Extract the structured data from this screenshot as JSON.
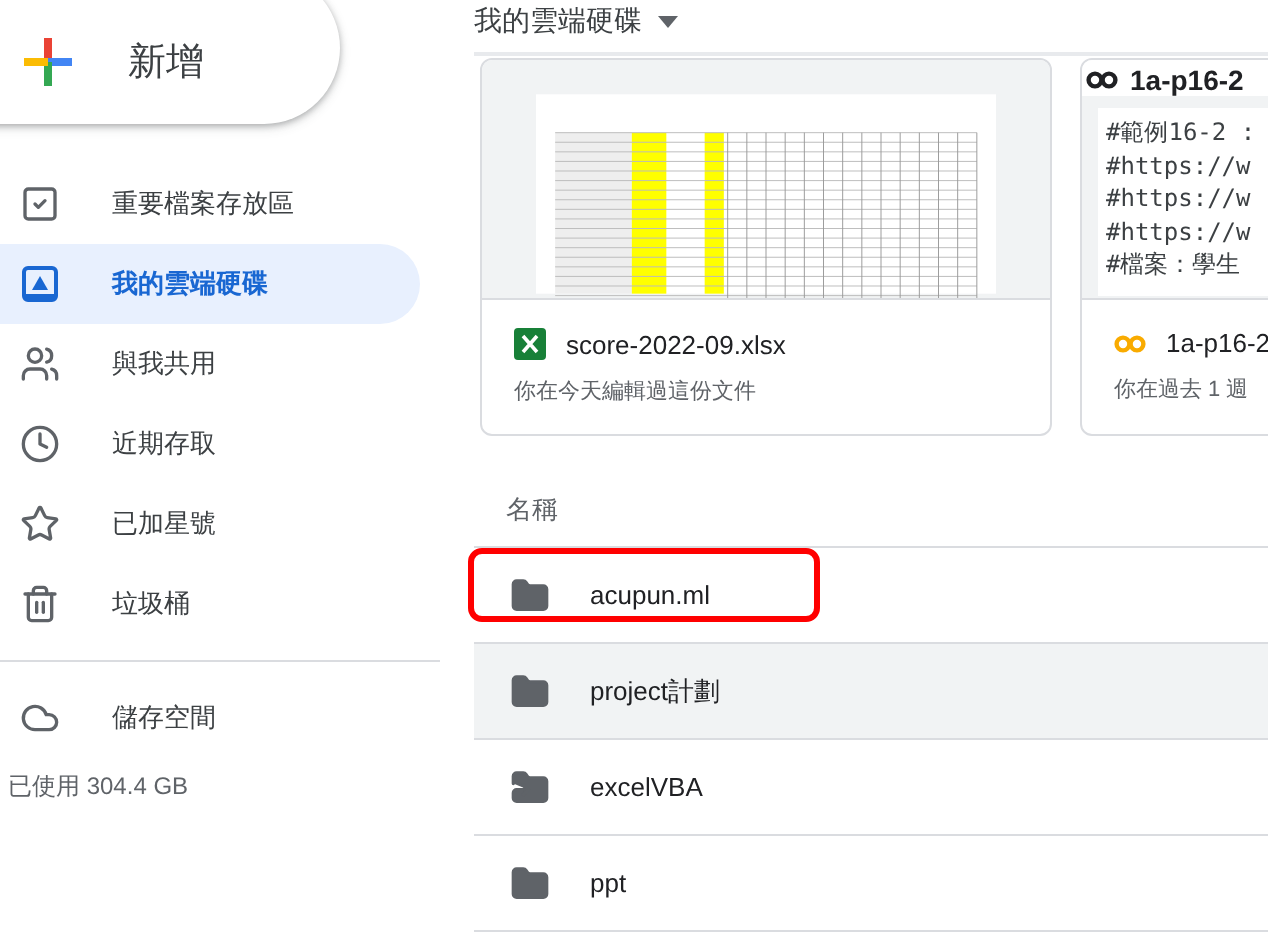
{
  "new_button": {
    "label": "新增"
  },
  "sidebar": {
    "items": [
      {
        "label": "重要檔案存放區",
        "kind": "check",
        "selected": false
      },
      {
        "label": "我的雲端硬碟",
        "kind": "drive",
        "selected": true
      },
      {
        "label": "與我共用",
        "kind": "people",
        "selected": false
      },
      {
        "label": "近期存取",
        "kind": "clock",
        "selected": false
      },
      {
        "label": "已加星號",
        "kind": "star",
        "selected": false
      },
      {
        "label": "垃圾桶",
        "kind": "trash",
        "selected": false
      }
    ],
    "storage": {
      "label": "儲存空間",
      "usage": "已使用 304.4 GB"
    }
  },
  "header": {
    "title": "我的雲端硬碟"
  },
  "suggested": [
    {
      "kind": "sheet",
      "name": "score-2022-09.xlsx",
      "activity": "你在今天編輯過這份文件"
    },
    {
      "kind": "colab",
      "name": "1a-p16-2",
      "preview_title": "1a-p16-2",
      "preview_lines": [
        "#範例16-2 :",
        "#https://w",
        "#https://w",
        "#https://w",
        "#檔案：學生"
      ],
      "activity": "你在過去 1 週"
    }
  ],
  "list": {
    "column": "名稱",
    "rows": [
      {
        "name": "acupun.ml",
        "kind": "folder",
        "highlighted": true,
        "hovered": false
      },
      {
        "name": "project計劃",
        "kind": "folder",
        "highlighted": false,
        "hovered": true
      },
      {
        "name": "excelVBA",
        "kind": "shortcut",
        "highlighted": false,
        "hovered": false
      },
      {
        "name": "ppt",
        "kind": "folder",
        "highlighted": false,
        "hovered": false
      }
    ]
  }
}
